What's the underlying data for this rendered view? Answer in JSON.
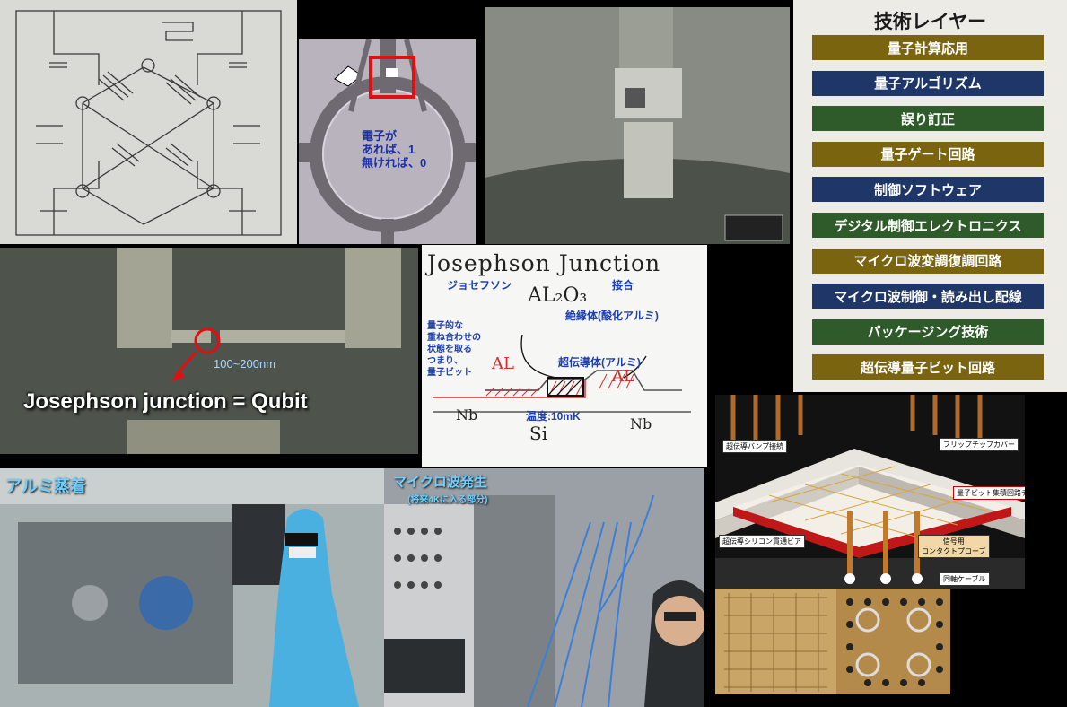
{
  "optical": {
    "caption_line1": "電子が",
    "caption_line2": "あれば、1",
    "caption_line3": "無ければ、0"
  },
  "layers": {
    "title": "技術レイヤー",
    "items": [
      {
        "label": "量子計算応用",
        "color": "#7a6410"
      },
      {
        "label": "量子アルゴリズム",
        "color": "#1f3768"
      },
      {
        "label": "誤り訂正",
        "color": "#2f5a2a"
      },
      {
        "label": "量子ゲート回路",
        "color": "#7a6410"
      },
      {
        "label": "制御ソフトウェア",
        "color": "#1f3768"
      },
      {
        "label": "デジタル制御エレクトロニクス",
        "color": "#2f5a2a"
      },
      {
        "label": "マイクロ波変調復調回路",
        "color": "#7a6410"
      },
      {
        "label": "マイクロ波制御・読み出し配線",
        "color": "#1f3768"
      },
      {
        "label": "パッケージング技術",
        "color": "#2f5a2a"
      },
      {
        "label": "超伝導量子ビット回路",
        "color": "#7a6410"
      }
    ]
  },
  "junction": {
    "size_label": "100~200nm",
    "title": "Josephson junction = Qubit"
  },
  "board": {
    "heading": "Josephson Junction",
    "josephson_ja": "ジョセフソン",
    "junction_ja": "接合",
    "oxide": "AL₂O₃",
    "insulator": "絶縁体(酸化アルミ)",
    "superposition": [
      "量子的な",
      "重ね合わせの",
      "状態を取る",
      "つまり、",
      "量子ビット"
    ],
    "superconductor": "超伝導体(アルミ)",
    "al_left": "AL",
    "al_right": "AL",
    "nb_left": "Nb",
    "nb_right": "Nb",
    "si": "Si",
    "temperature": "温度:10mK"
  },
  "package": {
    "labels": {
      "bump": "超伝導バンプ接続",
      "flip": "フリップチップカバー",
      "chip": "量子ビット集積回路チップ",
      "via": "超伝導シリコン貫通ビア",
      "probe1": "信号用",
      "probe2": "コンタクトプローブ",
      "coax": "同軸ケーブル"
    }
  },
  "lab": {
    "caption": "アルミ蒸着"
  },
  "microwave": {
    "caption": "マイクロ波発生",
    "sub": "(将来4Kに入る部分)"
  },
  "colors": {
    "caption_blue": "#6fd0ff",
    "accent_red": "#e01010"
  }
}
